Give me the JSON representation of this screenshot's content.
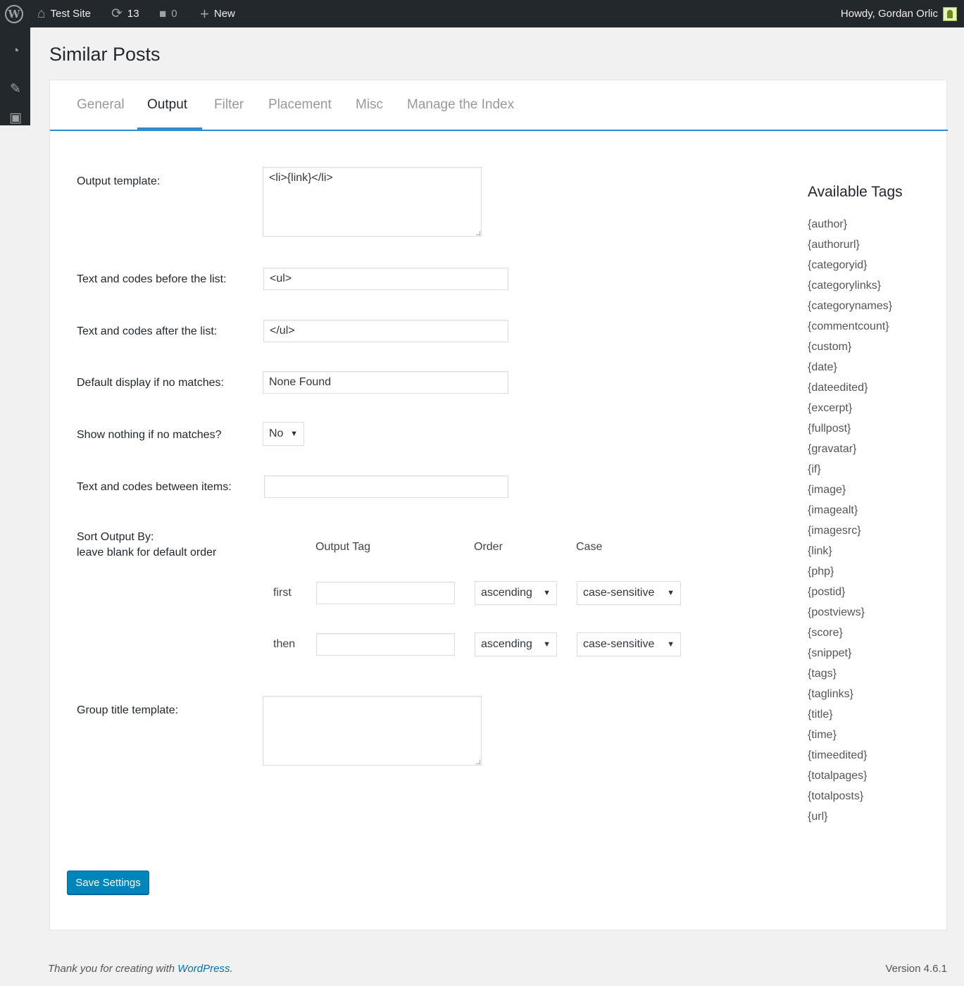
{
  "adminbar": {
    "site_name": "Test Site",
    "updates_count": "13",
    "comments_count": "0",
    "new_label": "New",
    "greeting": "Howdy, Gordan Orlic"
  },
  "page": {
    "title": "Similar Posts"
  },
  "tabs": [
    {
      "label": "General"
    },
    {
      "label": "Output"
    },
    {
      "label": "Filter"
    },
    {
      "label": "Placement"
    },
    {
      "label": "Misc"
    },
    {
      "label": "Manage the Index"
    }
  ],
  "active_tab": "Output",
  "form": {
    "output_template": {
      "label": "Output template:",
      "value": "<li>{link}</li>"
    },
    "before_list": {
      "label": "Text and codes before the list:",
      "value": "<ul>"
    },
    "after_list": {
      "label": "Text and codes after the list:",
      "value": "</ul>"
    },
    "no_matches_default": {
      "label": "Default display if no matches:",
      "value": "None Found"
    },
    "show_nothing": {
      "label": "Show nothing if no matches?",
      "value": "No"
    },
    "between_items": {
      "label": "Text and codes between items:",
      "value": ""
    },
    "sort": {
      "label_line1": "Sort Output By:",
      "label_line2": "leave blank for default order",
      "col_tag": "Output Tag",
      "col_order": "Order",
      "col_case": "Case",
      "rows": [
        {
          "label": "first",
          "tag": "",
          "order": "ascending",
          "case": "case-sensitive"
        },
        {
          "label": "then",
          "tag": "",
          "order": "ascending",
          "case": "case-sensitive"
        }
      ]
    },
    "group_title": {
      "label": "Group title template:",
      "value": ""
    },
    "save_label": "Save Settings"
  },
  "available_tags": {
    "title": "Available Tags",
    "items": [
      "{author}",
      "{authorurl}",
      "{categoryid}",
      "{categorylinks}",
      "{categorynames}",
      "{commentcount}",
      "{custom}",
      "{date}",
      "{dateedited}",
      "{excerpt}",
      "{fullpost}",
      "{gravatar}",
      "{if}",
      "{image}",
      "{imagealt}",
      "{imagesrc}",
      "{link}",
      "{php}",
      "{postid}",
      "{postviews}",
      "{score}",
      "{snippet}",
      "{tags}",
      "{taglinks}",
      "{title}",
      "{time}",
      "{timeedited}",
      "{totalpages}",
      "{totalposts}",
      "{url}"
    ]
  },
  "footer": {
    "thanks_prefix": "Thank you for creating with ",
    "thanks_link": "WordPress",
    "thanks_suffix": ".",
    "version": "Version 4.6.1"
  },
  "colors": {
    "accent": "#0085ba",
    "adminbar": "#23282d",
    "tab_line": "#2e8ccf"
  }
}
